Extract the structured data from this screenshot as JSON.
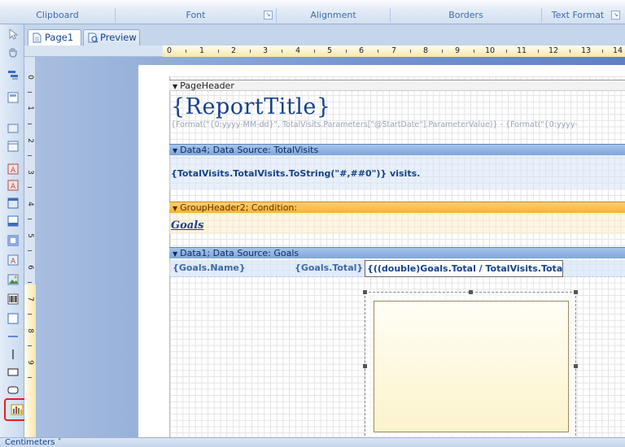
{
  "ribbon": {
    "groups": [
      {
        "label": "Clipboard"
      },
      {
        "label": "Font"
      },
      {
        "label": "Alignment"
      },
      {
        "label": "Borders"
      },
      {
        "label": "Text Format"
      }
    ]
  },
  "tabs": [
    {
      "label": "Page1",
      "active": true
    },
    {
      "label": "Preview",
      "active": false
    }
  ],
  "ruler": {
    "h_numbers": [
      "0",
      "1",
      "2",
      "3",
      "4",
      "5",
      "6",
      "7",
      "8",
      "9",
      "10",
      "11",
      "12",
      "13",
      "14"
    ],
    "v_numbers": [
      "0",
      "1",
      "2",
      "3",
      "4",
      "5",
      "6",
      "7",
      "8",
      "9"
    ]
  },
  "report": {
    "page_header_band": "PageHeader",
    "title": "{ReportTitle}",
    "subtitle_expr": "{Format(\"{0:yyyy-MM-dd}\", TotalVisits.Parameters[\"@StartDate\"].ParameterValue)} - {Format(\"{0:yyyy-",
    "data4_band": "Data4; Data Source: TotalVisits",
    "visits_expr": "{TotalVisits.TotalVisits.ToString(\"#,##0\")} visits.",
    "group_band": "GroupHeader2; Condition:",
    "goals_label": "Goals",
    "data1_band": "Data1; Data Source: Goals",
    "cells": {
      "name": "{Goals.Name}",
      "total": "{Goals.Total}",
      "ratio": "{((double)Goals.Total / TotalVisits.Tota"
    }
  },
  "statusbar": {
    "units": "Centimeters ˄"
  },
  "colors": {
    "accent": "#15428b",
    "data_band": "#7ea6dc",
    "group_band": "#f6b23a",
    "highlight": "#e02020"
  }
}
